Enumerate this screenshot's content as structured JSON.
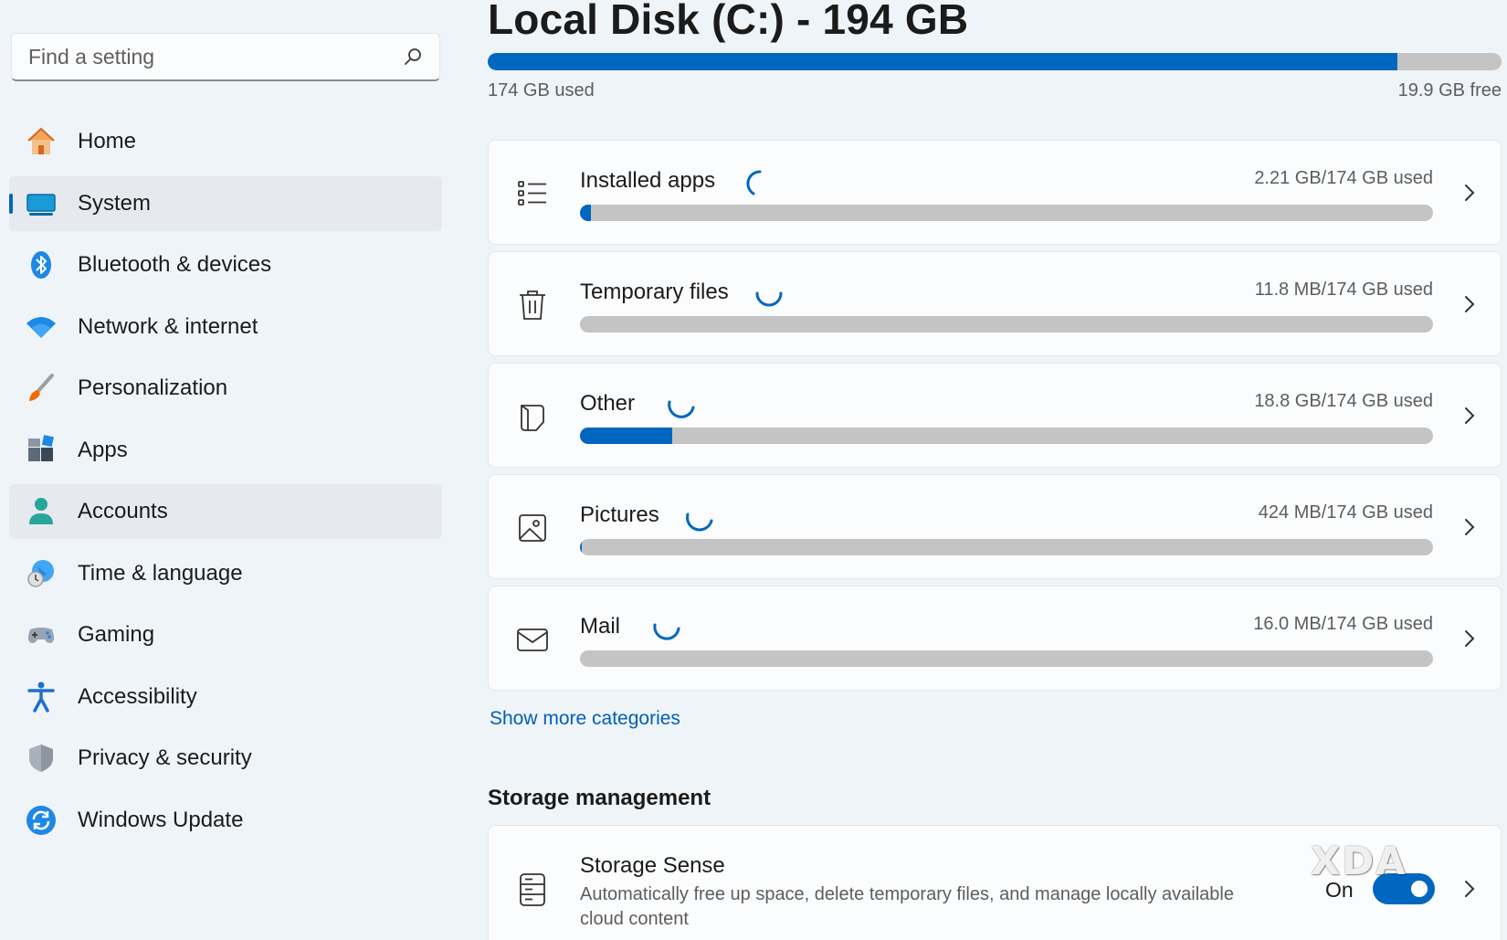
{
  "search": {
    "placeholder": "Find a setting",
    "icon": "search-icon"
  },
  "sidebar": {
    "items": [
      {
        "label": "Home",
        "icon": "home-icon"
      },
      {
        "label": "System",
        "icon": "system-display-icon",
        "active": true
      },
      {
        "label": "Bluetooth & devices",
        "icon": "bluetooth-icon"
      },
      {
        "label": "Network & internet",
        "icon": "wifi-icon"
      },
      {
        "label": "Personalization",
        "icon": "paintbrush-icon"
      },
      {
        "label": "Apps",
        "icon": "apps-icon"
      },
      {
        "label": "Accounts",
        "icon": "person-icon",
        "hover": true
      },
      {
        "label": "Time & language",
        "icon": "globe-clock-icon"
      },
      {
        "label": "Gaming",
        "icon": "gamepad-icon"
      },
      {
        "label": "Accessibility",
        "icon": "accessibility-icon"
      },
      {
        "label": "Privacy & security",
        "icon": "shield-icon"
      },
      {
        "label": "Windows Update",
        "icon": "update-icon"
      }
    ]
  },
  "disk": {
    "title": "Local Disk (C:) - 194 GB",
    "used_label": "174 GB used",
    "free_label": "19.9 GB free",
    "used_fraction": 0.897
  },
  "categories": [
    {
      "name": "Installed apps",
      "size": "2.21 GB/174 GB used",
      "fraction": 0.013,
      "icon": "list-icon"
    },
    {
      "name": "Temporary files",
      "size": "11.8 MB/174 GB used",
      "fraction": 0.0,
      "icon": "trash-icon"
    },
    {
      "name": "Other",
      "size": "18.8 GB/174 GB used",
      "fraction": 0.108,
      "icon": "document-icon"
    },
    {
      "name": "Pictures",
      "size": "424 MB/174 GB used",
      "fraction": 0.0024,
      "icon": "image-icon"
    },
    {
      "name": "Mail",
      "size": "16.0 MB/174 GB used",
      "fraction": 0.0,
      "icon": "mail-icon"
    }
  ],
  "show_more": "Show more categories",
  "storage_management": {
    "title": "Storage management",
    "storage_sense": {
      "title": "Storage Sense",
      "description": "Automatically free up space, delete temporary files, and manage locally available cloud content",
      "state": "On",
      "enabled": true,
      "icon": "storage-drive-icon"
    }
  },
  "watermark": "XDA",
  "colors": {
    "accent": "#0067c0",
    "background": "#eff4f9",
    "bar_track": "#c4c4c4",
    "link": "#005fb8"
  }
}
